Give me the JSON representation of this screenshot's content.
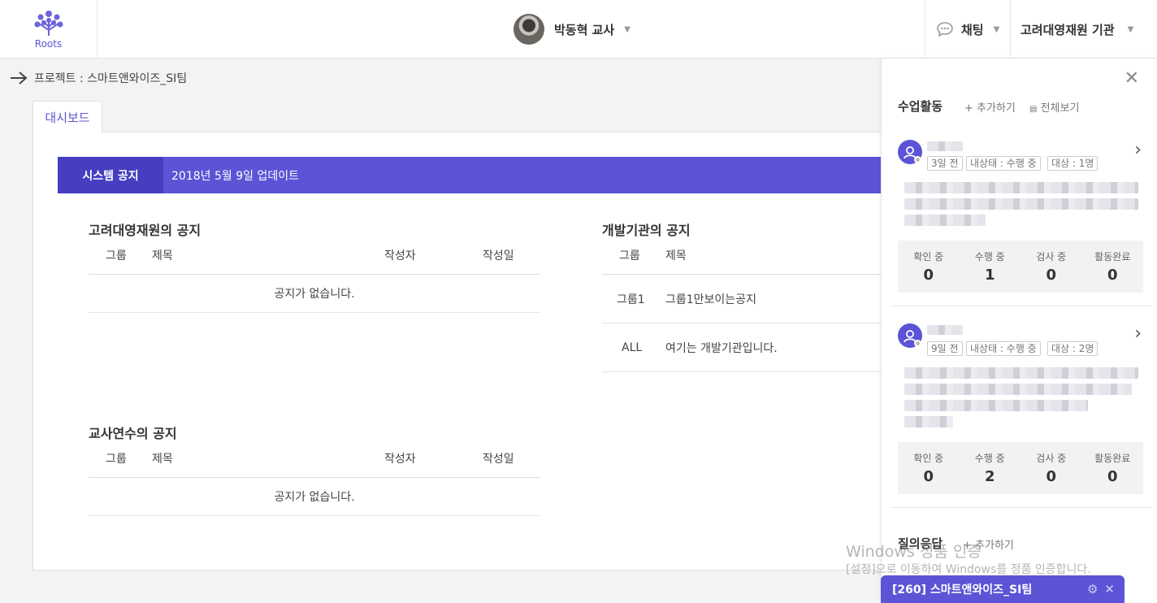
{
  "header": {
    "logo_text": "Roots",
    "user_name": "박동혁 교사",
    "chat_label": "채팅",
    "org_label": "고려대영재원 기관"
  },
  "breadcrumb": {
    "text": "프로젝트 : 스마트앤와이즈_SI팀"
  },
  "tabs": [
    {
      "label": "대시보드"
    }
  ],
  "notice_bar": {
    "tag": "시스템 공지",
    "text": "2018년 5월 9일 업데이트"
  },
  "sections": {
    "korea": {
      "title": "고려대영재원의 공지",
      "columns": [
        "그룹",
        "제목",
        "작성자",
        "작성일"
      ],
      "empty_text": "공지가 없습니다."
    },
    "dev": {
      "title": "개발기관의 공지",
      "columns": [
        "그룹",
        "제목"
      ],
      "rows": [
        {
          "group": "그룹1",
          "title": "그룹1만보이는공지"
        },
        {
          "group": "ALL",
          "title": "여기는 개발기관입니다."
        }
      ]
    },
    "training": {
      "title": "교사연수의 공지",
      "columns": [
        "그룹",
        "제목",
        "작성자",
        "작성일"
      ],
      "empty_text": "공지가 없습니다."
    }
  },
  "side": {
    "title": "수업활동",
    "add_label": "+ 추가하기",
    "view_all_label": "전체보기",
    "cards": [
      {
        "chips": [
          "3일 전",
          "내상태 : 수행 중",
          "대상 : 1명"
        ],
        "stats": [
          {
            "label": "확인 중",
            "value": "0"
          },
          {
            "label": "수행 중",
            "value": "1"
          },
          {
            "label": "검사 중",
            "value": "0"
          },
          {
            "label": "활동완료",
            "value": "0"
          }
        ]
      },
      {
        "chips": [
          "9일 전",
          "내상태 : 수행 중",
          "대상 : 2명"
        ],
        "stats": [
          {
            "label": "확인 중",
            "value": "0"
          },
          {
            "label": "수행 중",
            "value": "2"
          },
          {
            "label": "검사 중",
            "value": "0"
          },
          {
            "label": "활동완료",
            "value": "0"
          }
        ]
      }
    ],
    "qa_title": "질의응답",
    "qa_add_label": "+ 추가하기"
  },
  "watermark": {
    "line1": "Windows 정품 인증",
    "line2": "[설정]으로 이동하여 Windows를 정품 인증합니다."
  },
  "chat_popup": {
    "title": "[260] 스마트앤와이즈_SI팀"
  },
  "colors": {
    "accent": "#5b54d6",
    "accent_dark": "#453ec0"
  }
}
